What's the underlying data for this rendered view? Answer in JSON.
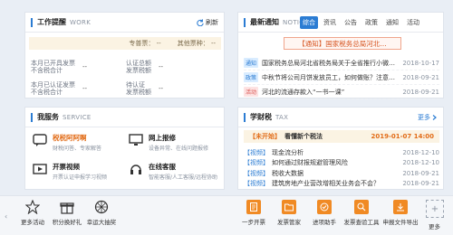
{
  "work": {
    "title": "工作提醒",
    "subtitle": "WORK",
    "refresh": "刷新",
    "special_ticket_label": "专普票：",
    "special_ticket_value": "--",
    "other_ticket_label": "其他票种：",
    "other_ticket_value": "--",
    "rows": [
      [
        {
          "label1": "本月已开具发票",
          "label2": "不含税合计",
          "value": "--"
        },
        {
          "label1": "认证总额",
          "label2": "发票税额",
          "value": "--"
        }
      ],
      [
        {
          "label1": "本月已认证发票",
          "label2": "不含税合计",
          "value": "--"
        },
        {
          "label1": "待认证",
          "label2": "发票税额",
          "value": "--"
        }
      ]
    ]
  },
  "news": {
    "title": "最新通知",
    "subtitle": "NOTICE",
    "tabs": [
      "综合",
      "资讯",
      "公告",
      "政策",
      "通知",
      "活动"
    ],
    "headline": "【通知】国家税务总局河北…",
    "items": [
      {
        "tag": "通知",
        "text": "国家税务总局河北省税务局关于全省推行小微…",
        "date": "2018-10-17"
      },
      {
        "tag": "政策",
        "text": "中秋节将公司月饼发放员工，如何做账？注意…",
        "date": "2018-09-21"
      },
      {
        "tag": "活动",
        "text": "河北的流通存款入“一书一课”",
        "date": "2018-09-21"
      }
    ]
  },
  "services": {
    "title": "我服务",
    "subtitle": "SERVICE",
    "items": [
      {
        "name": "税税阿阿啊",
        "desc": "财税问答、专家解答"
      },
      {
        "name": "网上报修",
        "desc": "设备异常、在线问题报修"
      },
      {
        "name": "开票视频",
        "desc": "开票认证申报学习视频"
      },
      {
        "name": "在线客服",
        "desc": "智能客服/人工客服/远程协助"
      }
    ]
  },
  "tax": {
    "title": "学财税",
    "subtitle": "TAX",
    "more": "更多",
    "notice_status": "【未开始】",
    "notice_title": "看懂新个税法",
    "notice_time": "2019-01-07 14:00",
    "items": [
      {
        "tag": "【视频】",
        "text": "现金流分析",
        "date": "2018-12-10"
      },
      {
        "tag": "【视频】",
        "text": "如何通过财报规避管理风险",
        "date": "2018-12-10"
      },
      {
        "tag": "【视频】",
        "text": "税收大数据",
        "date": "2018-09-21"
      },
      {
        "tag": "【视频】",
        "text": "建筑房地产业营改增相关业务会不会？",
        "date": "2018-09-21"
      }
    ]
  },
  "bottom": {
    "left_items": [
      "更多活动",
      "积分换好礼",
      "幸运大抽奖"
    ],
    "right_items": [
      "一步开票",
      "发票管家",
      "进项助手",
      "发票查验工具",
      "申报文件导出"
    ],
    "more": "更多"
  }
}
